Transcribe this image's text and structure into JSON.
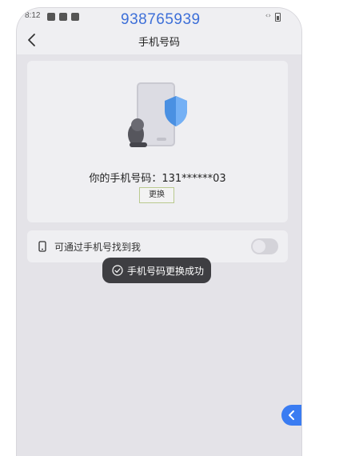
{
  "status_bar": {
    "time": "8:12"
  },
  "overlay_number": "938765939",
  "header": {
    "title": "手机号码"
  },
  "card": {
    "phone_number_text": "你的手机号码：131******03",
    "change_button": "更换"
  },
  "setting": {
    "label": "可通过手机号找到我",
    "toggle_on": false
  },
  "toast": {
    "text": "手机号码更换成功"
  },
  "colors": {
    "accent": "#3a7cf2",
    "shield": "#4a90e2",
    "toast_bg": "#3e3e42"
  },
  "icons": [
    "back-arrow-icon",
    "phone-shield-illustration",
    "mobile-phone-icon",
    "check-circle-icon",
    "chevron-left-icon"
  ]
}
